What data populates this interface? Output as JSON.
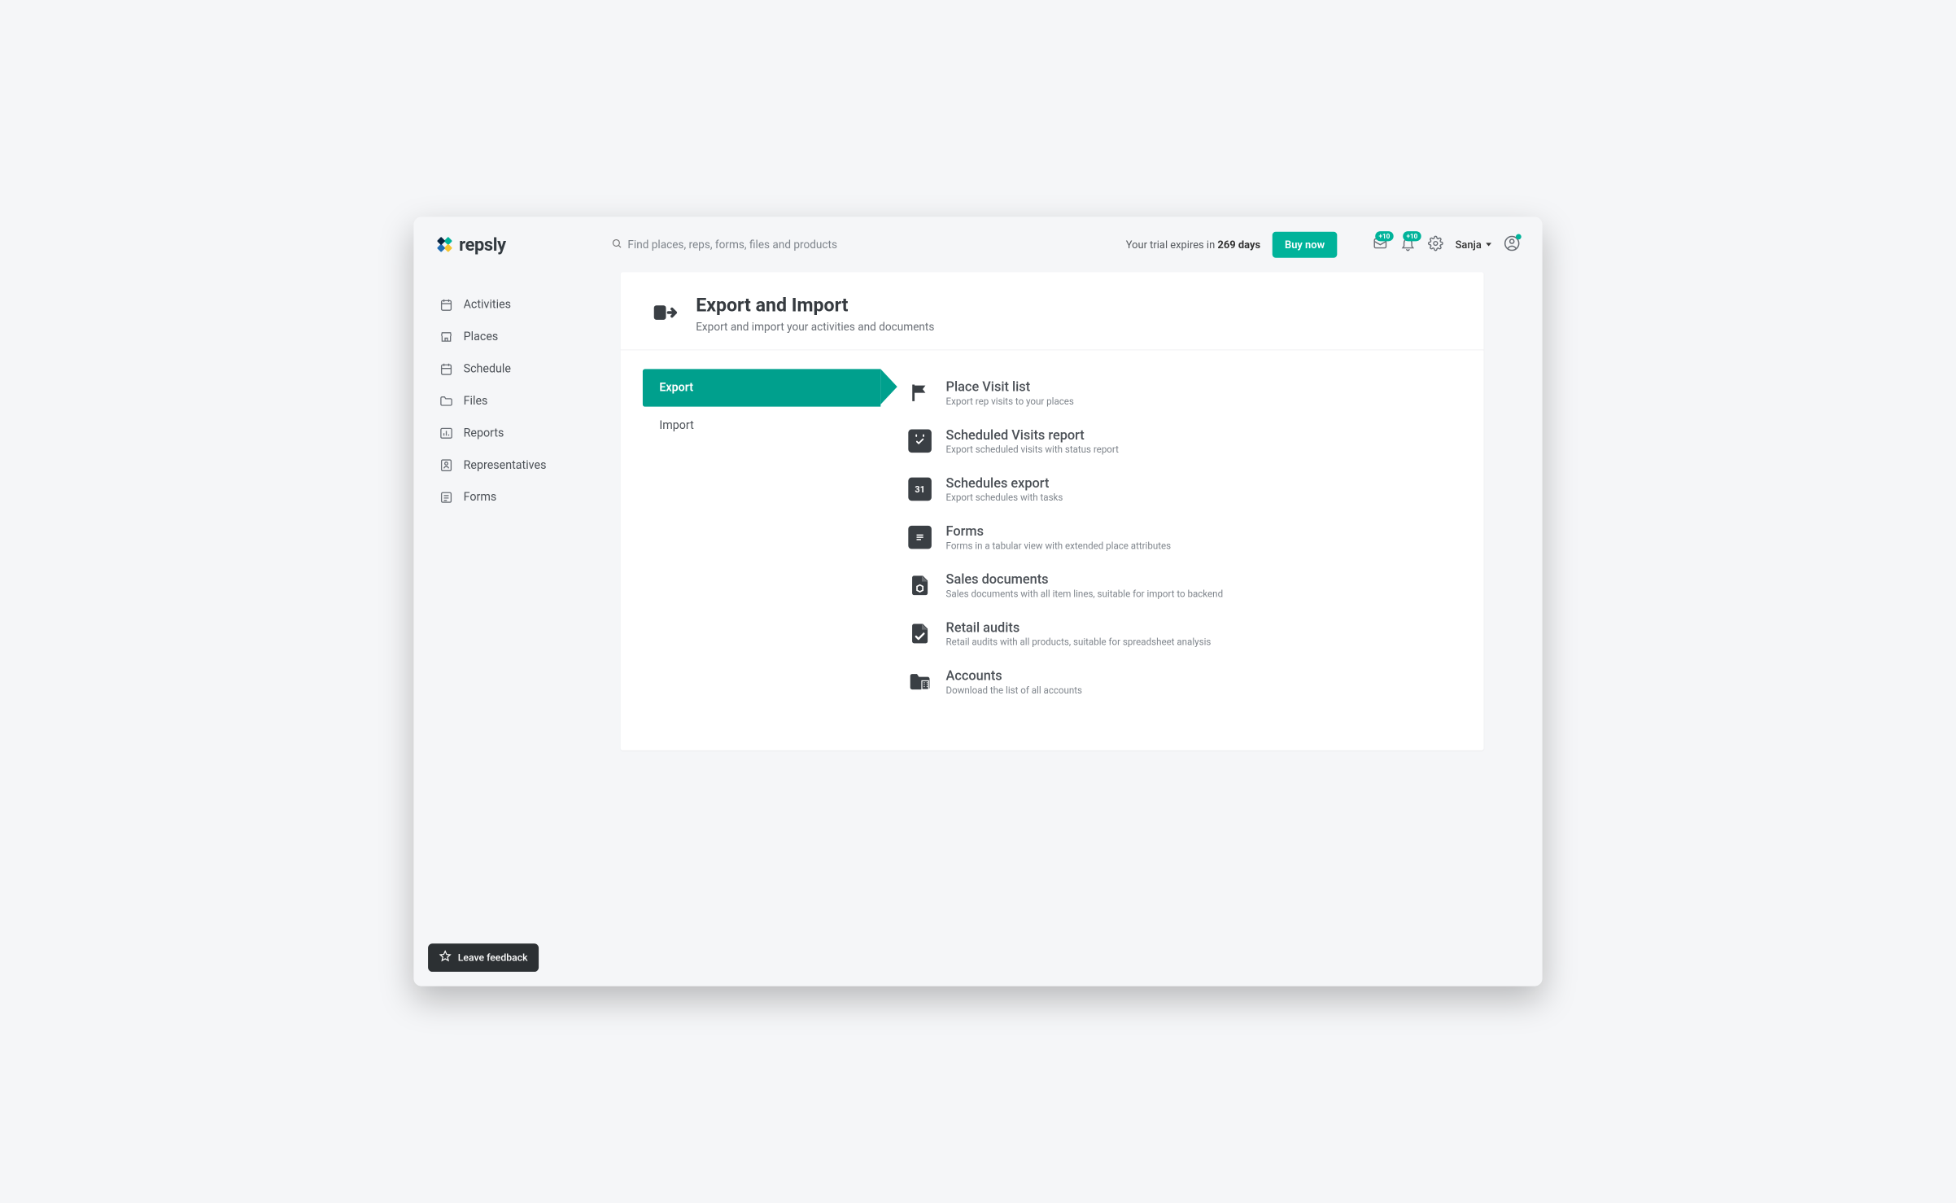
{
  "brand": {
    "name": "repsly"
  },
  "search": {
    "placeholder": "Find places, reps, forms, files and products"
  },
  "trial": {
    "prefix": "Your trial expires in ",
    "days": "269 days"
  },
  "topbar": {
    "buy_label": "Buy now",
    "inbox_badge": "+10",
    "bell_badge": "+10",
    "user_name": "Sanja"
  },
  "sidebar": {
    "items": [
      {
        "label": "Activities"
      },
      {
        "label": "Places"
      },
      {
        "label": "Schedule"
      },
      {
        "label": "Files"
      },
      {
        "label": "Reports"
      },
      {
        "label": "Representatives"
      },
      {
        "label": "Forms"
      }
    ]
  },
  "page": {
    "title": "Export and Import",
    "subtitle": "Export and import your activities and documents"
  },
  "tabs": {
    "export": "Export",
    "import": "Import"
  },
  "exports": [
    {
      "title": "Place Visit list",
      "desc": "Export rep visits to your places"
    },
    {
      "title": "Scheduled Visits report",
      "desc": "Export scheduled visits with status report"
    },
    {
      "title": "Schedules export",
      "desc": "Export schedules with tasks"
    },
    {
      "title": "Forms",
      "desc": "Forms in a tabular view with extended place attributes"
    },
    {
      "title": "Sales documents",
      "desc": "Sales documents with all item lines, suitable for import to backend"
    },
    {
      "title": "Retail audits",
      "desc": "Retail audits with all products, suitable for spreadsheet analysis"
    },
    {
      "title": "Accounts",
      "desc": "Download the list of all accounts"
    }
  ],
  "feedback": {
    "label": "Leave feedback"
  }
}
